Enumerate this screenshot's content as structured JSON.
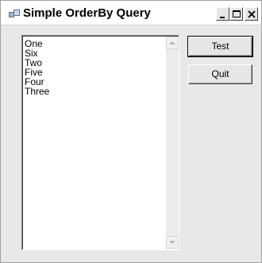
{
  "window": {
    "title": "Simple OrderBy Query",
    "icon": "app-icon",
    "caption_buttons": [
      "minimize-icon",
      "maximize-icon",
      "close-icon"
    ]
  },
  "listbox": {
    "items": [
      "One",
      "Six",
      "Two",
      "Five",
      "Four",
      "Three"
    ]
  },
  "buttons": {
    "test_label": "Test",
    "quit_label": "Quit"
  }
}
